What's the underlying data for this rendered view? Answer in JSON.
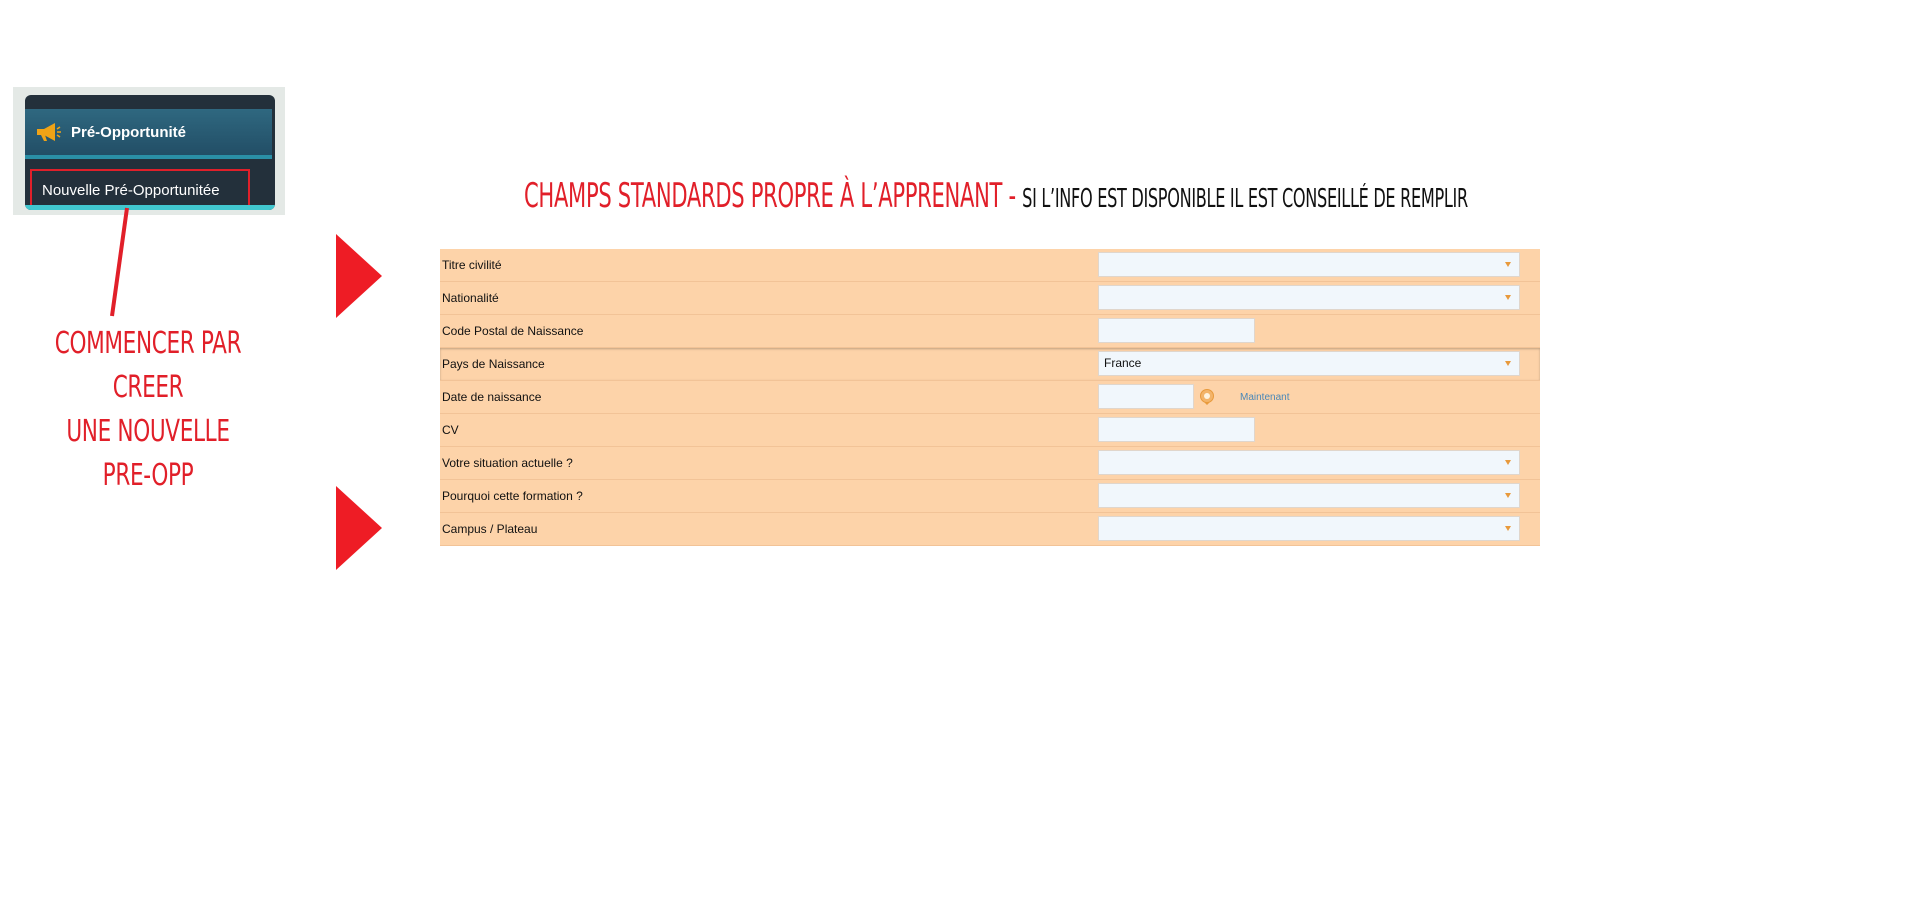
{
  "menu": {
    "header_label": "Pré-Opportunité",
    "header_icon": "megaphone-icon",
    "item_label": "Nouvelle Pré-Opportunitée"
  },
  "callout": {
    "line1": "Commencer par creer",
    "line2": "une nouvelle pre-opp"
  },
  "title": {
    "red_part": "Champs standards propre à l’apprenant - ",
    "black_part": "si l’info est disponible il est conseillé de remplir"
  },
  "form": {
    "fields": [
      {
        "label": "Titre civilité",
        "type": "select",
        "value": ""
      },
      {
        "label": "Nationalité",
        "type": "select",
        "value": ""
      },
      {
        "label": "Code Postal de Naissance",
        "type": "text",
        "value": ""
      },
      {
        "label": "Pays de Naissance",
        "type": "select",
        "value": "France"
      },
      {
        "label": "Date de naissance",
        "type": "date",
        "value": "",
        "now_link": "Maintenant"
      },
      {
        "label": "CV",
        "type": "text",
        "value": ""
      },
      {
        "label": "Votre situation actuelle ?",
        "type": "select",
        "value": ""
      },
      {
        "label": "Pourquoi cette formation ?",
        "type": "select",
        "value": ""
      },
      {
        "label": "Campus / Plateau",
        "type": "select",
        "value": ""
      }
    ]
  },
  "colors": {
    "accent_red": "#e11f29",
    "form_bg": "#fdd3a9",
    "caret": "#e89a3c",
    "menu_bg": "#23303b"
  }
}
